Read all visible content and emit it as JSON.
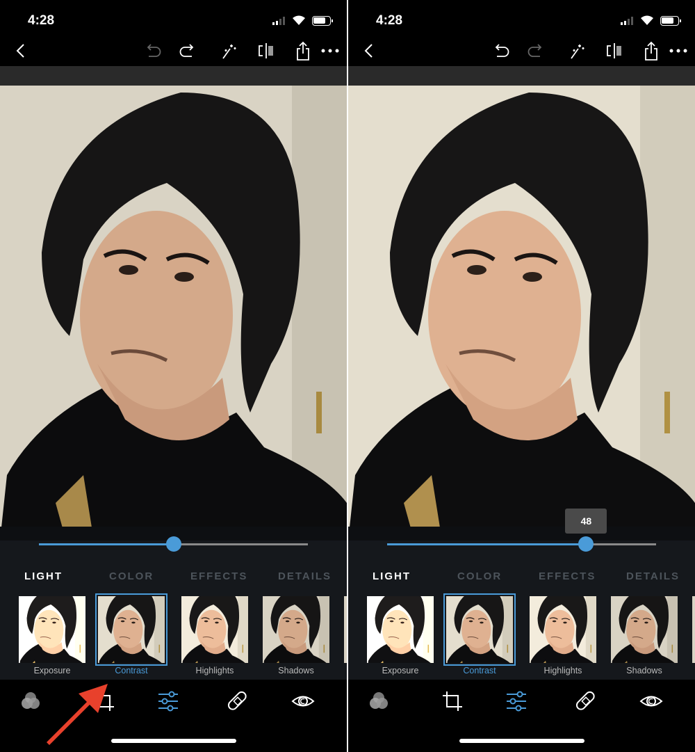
{
  "accent_color": "#4a9bd8",
  "annotation_color": "#e8412c",
  "panels": [
    {
      "status_time": "4:28",
      "toolbar": {
        "icons": [
          "back-icon",
          "undo-icon",
          "redo-icon",
          "magic-wand-icon",
          "compare-icon",
          "share-icon",
          "more-icon"
        ],
        "undo_enabled": false,
        "redo_enabled": true
      },
      "slider": {
        "min": -100,
        "max": 100,
        "value": 0,
        "tooltip": ""
      },
      "tabs": [
        "LIGHT",
        "COLOR",
        "EFFECTS",
        "DETAILS"
      ],
      "active_tab": 0,
      "adjustments": [
        "Exposure",
        "Contrast",
        "Highlights",
        "Shadows"
      ],
      "selected_adjustment": 1,
      "bottom_nav": [
        "looks-icon",
        "crop-icon",
        "adjustments-icon",
        "healing-icon",
        "eye-icon"
      ],
      "active_nav": 2,
      "annotation": "red-arrow pointing at Contrast"
    },
    {
      "status_time": "4:28",
      "toolbar": {
        "icons": [
          "back-icon",
          "undo-icon",
          "redo-icon",
          "magic-wand-icon",
          "compare-icon",
          "share-icon",
          "more-icon"
        ],
        "undo_enabled": true,
        "redo_enabled": false
      },
      "slider": {
        "min": -100,
        "max": 100,
        "value": 48,
        "tooltip": "48"
      },
      "tabs": [
        "LIGHT",
        "COLOR",
        "EFFECTS",
        "DETAILS"
      ],
      "active_tab": 0,
      "adjustments": [
        "Exposure",
        "Contrast",
        "Highlights",
        "Shadows"
      ],
      "selected_adjustment": 1,
      "bottom_nav": [
        "looks-icon",
        "crop-icon",
        "adjustments-icon",
        "healing-icon",
        "eye-icon"
      ],
      "active_nav": 2
    }
  ]
}
